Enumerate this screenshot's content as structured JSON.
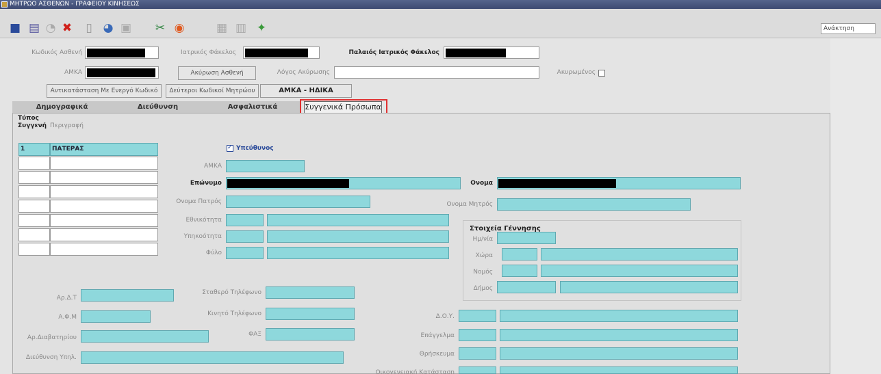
{
  "window": {
    "title": "ΜΗΤΡΩΟ ΑΣΘΕΝΩΝ - ΓΡΑΦΕΙΟΥ ΚΙΝΗΣΕΩΣ"
  },
  "toolbar": {
    "retrieval": "Ανάκτηση",
    "icons": [
      "save-icon",
      "print-icon",
      "search-icon",
      "delete-icon",
      "new-record-icon",
      "help-icon",
      "print-preview-icon",
      "cut-icon",
      "stop-icon",
      "grid-icon",
      "list-icon",
      "wizard-icon"
    ]
  },
  "header": {
    "patient_code_label": "Κωδικός Ασθενή",
    "medical_folder_label": "Ιατρικός Φάκελος",
    "old_medical_folder_label": "Παλαιός Ιατρικός Φάκελος",
    "amka_label": "ΑΜΚΑ",
    "cancel_patient_button": "Ακύρωση Ασθενή",
    "cancel_reason_label": "Λόγος Ακύρωσης",
    "cancelled_label": "Ακυρωμένος",
    "replace_button": "Αντικατάσταση Με Ενεργό Κωδικό",
    "secondary_codes_button": "Δεύτεροι Κωδικοί Μητρώου",
    "amka_ida_button": "ΑΜΚΑ - ΗΔΙΚΑ"
  },
  "tabs": [
    {
      "label": "Δημογραφικά"
    },
    {
      "label": "Διεύθυνση"
    },
    {
      "label": "Ασφαλιστικά"
    },
    {
      "label": "Συγγενικά Πρόσωπα"
    }
  ],
  "relatives": {
    "col_type": "Τύπος Συγγενή",
    "col_desc": "Περιγραφή",
    "rows": [
      {
        "type": "1",
        "desc": "ΠΑΤΕΡΑΣ"
      }
    ]
  },
  "form": {
    "responsible_label": "Υπεύθυνος",
    "amka": "ΑΜΚΑ",
    "surname": "Επώνυμο",
    "name": "Ονομα",
    "father_name": "Ονομα Πατρός",
    "mother_name": "Ονομα Μητρός",
    "nationality": "Εθνικότητα",
    "citizenship": "Υπηκοότητα",
    "sex": "Φύλο",
    "birth_group": "Στοιχεία Γέννησης",
    "birth_date": "Ημ/νία",
    "country": "Χώρα",
    "prefecture": "Νομός",
    "municipality": "Δήμος",
    "id_number": "Αρ.Δ.Τ",
    "afm": "Α.Φ.Μ",
    "passport": "Αρ.Διαβατηρίου",
    "email": "Διεύθυνση Υπηλ.",
    "landline": "Σταθερό Τηλέφωνο",
    "mobile": "Κινητό Τηλέφωνο",
    "fax": "ΦΑΞ",
    "doy": "Δ.Ο.Υ.",
    "profession": "Επάγγελμα",
    "education": "Θρήσκευμα",
    "family_status": "Οικογενειακή Κατάσταση"
  }
}
